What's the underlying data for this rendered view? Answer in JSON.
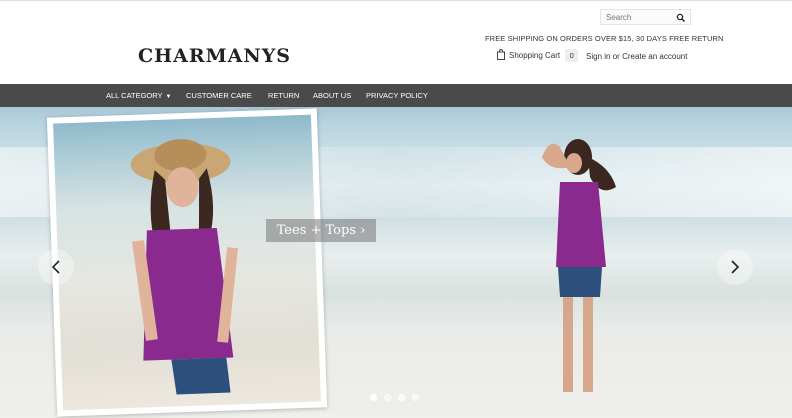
{
  "brand": {
    "logo_text": "CHARMANYS"
  },
  "search": {
    "placeholder": "Search",
    "icon": "search-icon"
  },
  "promo": {
    "shipping": "FREE SHIPPING ON ORDERS OVER $15, 30 DAYS FREE RETURN"
  },
  "cart": {
    "label": "Shopping Cart",
    "count": "0",
    "icon": "shopping-bag-icon"
  },
  "account": {
    "sign_in": "Sign in",
    "or": "or",
    "create": "Create an account"
  },
  "nav": {
    "items": [
      {
        "label": "ALL CATEGORY",
        "has_dropdown": true
      },
      {
        "label": "CUSTOMER CARE"
      },
      {
        "label": "RETURN"
      },
      {
        "label": "ABOUT US"
      },
      {
        "label": "PRIVACY POLICY"
      }
    ]
  },
  "slider": {
    "caption": "Tees + Tops ›",
    "prev_icon": "chevron-left-icon",
    "next_icon": "chevron-right-icon",
    "slide_count": 4,
    "active_slide": 1
  },
  "colors": {
    "nav_bg": "#4a4a4a",
    "accent_purple": "#8a2a8f"
  }
}
